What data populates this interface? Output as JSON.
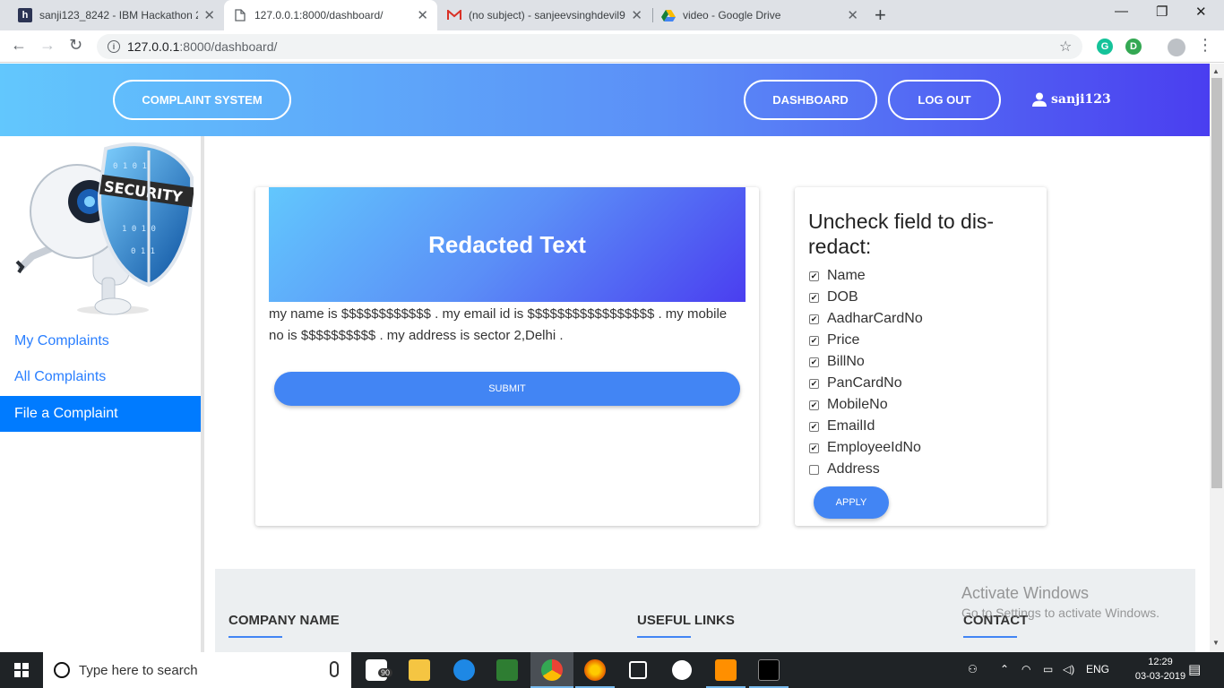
{
  "browser": {
    "tabs": [
      {
        "title": "sanji123_8242 - IBM Hackathon 2",
        "icon": "hackerearth-icon",
        "active": false
      },
      {
        "title": "127.0.0.1:8000/dashboard/",
        "icon": "page-icon",
        "active": true
      },
      {
        "title": "(no subject) - sanjeevsinghdevil9",
        "icon": "gmail-icon",
        "active": false
      },
      {
        "title": "video - Google Drive",
        "icon": "google-drive-icon",
        "active": false
      }
    ],
    "url_host": "127.0.0.1",
    "url_path": ":8000/dashboard/",
    "new_tab": "+"
  },
  "header": {
    "brand": "COMPLAINT SYSTEM",
    "dashboard": "DASHBOARD",
    "logout": "LOG OUT",
    "username": "sanji123"
  },
  "sidebar": {
    "logo_text": "SECURITY",
    "items": [
      {
        "label": "My Complaints",
        "active": false
      },
      {
        "label": "All Complaints",
        "active": false
      },
      {
        "label": "File a Complaint",
        "active": true
      }
    ]
  },
  "redacted": {
    "title": "Redacted Text",
    "text": "my name is $$$$$$$$$$$$ . my email id is $$$$$$$$$$$$$$$$$ . my mobile no is $$$$$$$$$$ . my address is sector 2,Delhi .",
    "submit": "SUBMIT"
  },
  "options": {
    "title": "Uncheck field to dis-redact:",
    "fields": [
      {
        "label": "Name",
        "checked": true
      },
      {
        "label": "DOB",
        "checked": true
      },
      {
        "label": "AadharCardNo",
        "checked": true
      },
      {
        "label": "Price",
        "checked": true
      },
      {
        "label": "BillNo",
        "checked": true
      },
      {
        "label": "PanCardNo",
        "checked": true
      },
      {
        "label": "MobileNo",
        "checked": true
      },
      {
        "label": "EmailId",
        "checked": true
      },
      {
        "label": "EmployeeIdNo",
        "checked": true
      },
      {
        "label": "Address",
        "checked": false
      }
    ],
    "apply": "APPLY"
  },
  "footer": {
    "company": "COMPANY NAME",
    "links": "USEFUL LINKS",
    "contact": "CONTACT"
  },
  "watermark": {
    "line1": "Activate Windows",
    "line2": "Go to Settings to activate Windows."
  },
  "taskbar": {
    "search_placeholder": "Type here to search",
    "badge": "90",
    "language": "ENG",
    "time": "12:29",
    "date": "03-03-2019"
  },
  "colors": {
    "header_start": "#62c7fd",
    "header_end": "#4a3ef0",
    "accent": "#4285f4",
    "active_nav": "#007bff",
    "link": "#2a7fff"
  }
}
